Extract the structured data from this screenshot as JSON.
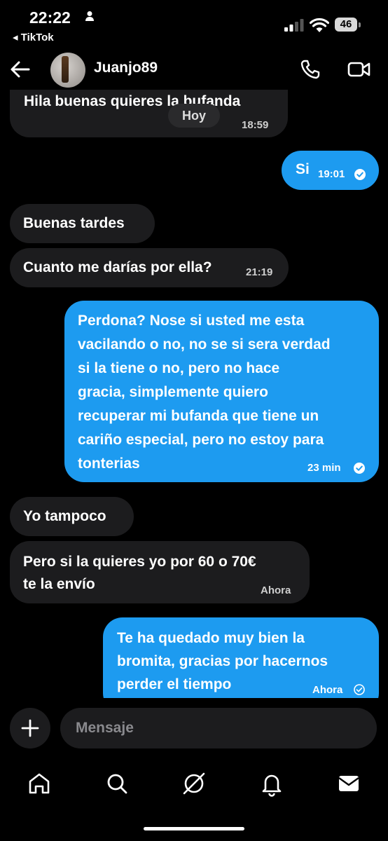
{
  "status_bar": {
    "time": "22:22",
    "back_app": "◂ TikTok",
    "battery": "46"
  },
  "header": {
    "contact_name": "Juanjo89",
    "icons": [
      "back-arrow-icon",
      "phone-icon",
      "video-camera-icon"
    ]
  },
  "chat": {
    "day_separator": "Hoy",
    "messages": [
      {
        "direction": "in",
        "lines": [
          "Hila buenas quieres la bufanda"
        ],
        "time": "18:59"
      },
      {
        "direction": "out",
        "lines": [
          "Si"
        ],
        "time": "19:01",
        "status": "read"
      },
      {
        "direction": "in",
        "lines": [
          "Buenas tardes"
        ],
        "time": ""
      },
      {
        "direction": "in",
        "lines": [
          "Cuanto me darías por ella?"
        ],
        "time": "21:19"
      },
      {
        "direction": "out",
        "lines": [
          "Perdona? Nose si usted me esta",
          "vacilando o no, no se si sera verdad",
          "si la tiene o no, pero no hace",
          "gracia, simplemente quiero",
          "recuperar mi bufanda que tiene un",
          "cariño especial, pero no estoy para",
          "tonterias"
        ],
        "time": "23 min",
        "status": "read"
      },
      {
        "direction": "in",
        "lines": [
          "Yo tampoco"
        ],
        "time": ""
      },
      {
        "direction": "in",
        "lines": [
          "Pero si la quieres yo por 60 o 70€",
          "te la envío"
        ],
        "time": "Ahora"
      },
      {
        "direction": "out",
        "lines": [
          "Te ha quedado muy bien la",
          "bromita, gracias por hacernos",
          "perder el tiempo"
        ],
        "time": "Ahora",
        "status": "sent"
      }
    ]
  },
  "composer": {
    "placeholder": "Mensaje"
  },
  "tabbar": {
    "items": [
      "home-icon",
      "search-icon",
      "grok-icon",
      "notifications-icon",
      "messages-icon"
    ]
  },
  "colors": {
    "background": "#000000",
    "incoming_bubble": "#1c1c1e",
    "outgoing_bubble": "#1d9bf0"
  }
}
